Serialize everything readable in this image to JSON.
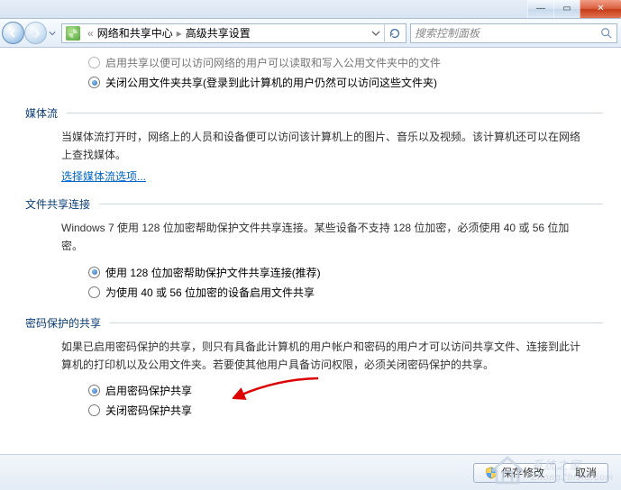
{
  "titlebar": {
    "minimize_glyph": "—",
    "maximize_glyph": "▭",
    "close_glyph": "✕"
  },
  "navbar": {
    "crumb1": "网络和共享中心",
    "crumb2": "高级共享设置",
    "sep": "▸",
    "search_placeholder": "搜索控制面板"
  },
  "top_options": {
    "opt_a": "启用共享以便可以访问网络的用户可以读取和写入公用文件夹中的文件",
    "opt_b": "关闭公用文件夹共享(登录到此计算机的用户仍然可以访问这些文件夹)"
  },
  "media": {
    "heading": "媒体流",
    "body": "当媒体流打开时，网络上的人员和设备便可以访问该计算机上的图片、音乐以及视频。该计算机还可以在网络上查找媒体。",
    "link": "选择媒体流选项..."
  },
  "encryption": {
    "heading": "文件共享连接",
    "body": "Windows 7 使用 128 位加密帮助保护文件共享连接。某些设备不支持 128 位加密，必须使用 40 或 56 位加密。",
    "opt_a": "使用 128 位加密帮助保护文件共享连接(推荐)",
    "opt_b": "为使用 40 或 56 位加密的设备启用文件共享"
  },
  "password": {
    "heading": "密码保护的共享",
    "body": "如果已启用密码保护的共享，则只有具备此计算机的用户帐户和密码的用户才可以访问共享文件、连接到此计算机的打印机以及公用文件夹。若要使其他用户具备访问权限，必须关闭密码保护的共享。",
    "opt_a": "启用密码保护共享",
    "opt_b": "关闭密码保护共享"
  },
  "bottom": {
    "save": "保存修改",
    "cancel": "取消"
  },
  "watermark": {
    "text": "系统之家",
    "url": "ZhongZhiJia.com"
  }
}
